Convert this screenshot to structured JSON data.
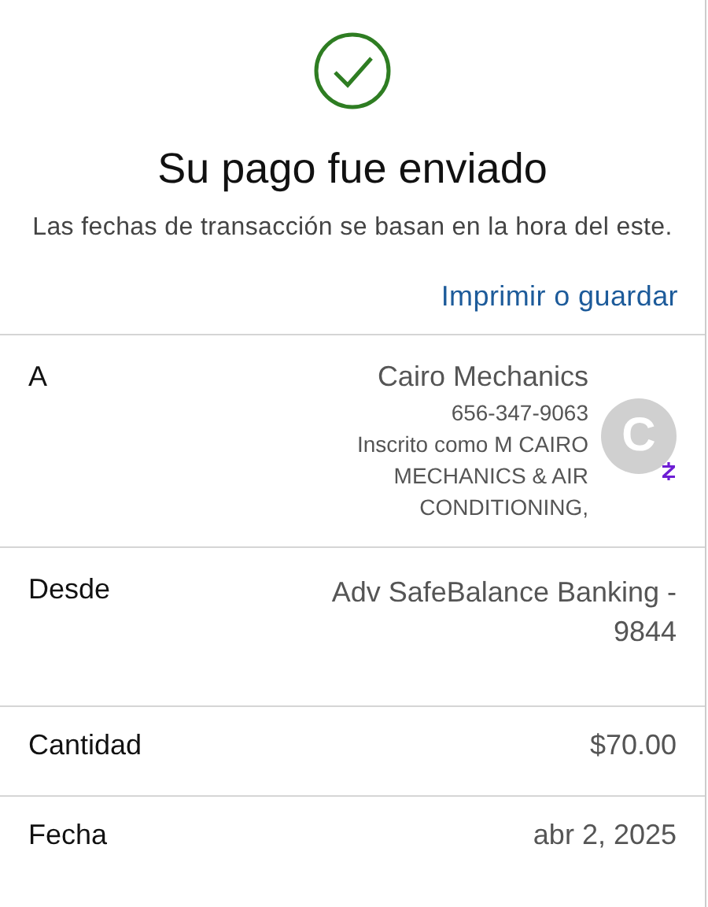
{
  "title": "Su pago fue enviado",
  "subtitle": "Las fechas de transacción se basan en la hora del este.",
  "print_link": "Imprimir o guardar",
  "recipient": {
    "label": "A",
    "name": "Cairo Mechanics",
    "phone": "656-347-9063",
    "enrolled_as": "Inscrito como M CAIRO MECHANICS & AIR CONDITIONING,",
    "avatar_letter": "C"
  },
  "details": [
    {
      "label": "Desde",
      "value": "Adv SafeBalance Banking - 9844"
    },
    {
      "label": "Cantidad",
      "value": "$70.00"
    },
    {
      "label": "Fecha",
      "value": "abr 2, 2025"
    }
  ]
}
